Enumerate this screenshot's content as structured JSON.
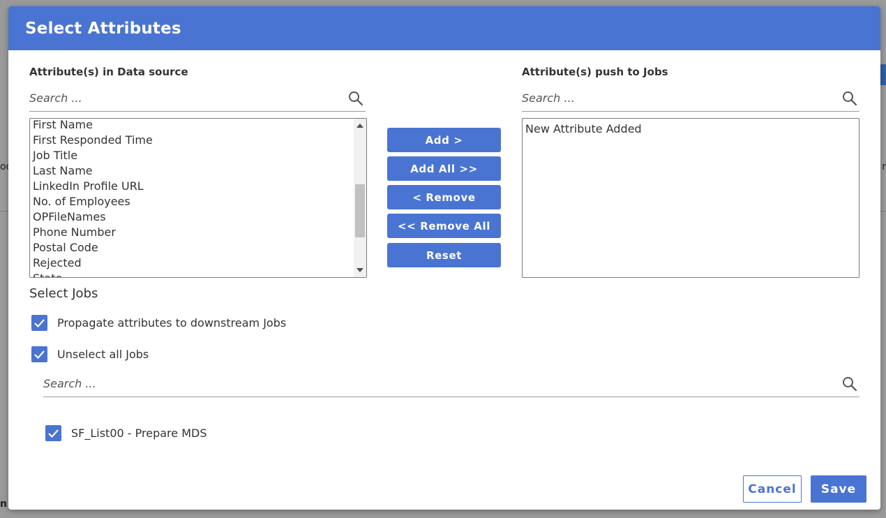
{
  "background": {
    "frag_left_1": "oo",
    "frag_right_1": "r",
    "frag_bottom_left": "n"
  },
  "modal": {
    "title": "Select Attributes"
  },
  "source_panel": {
    "label": "Attribute(s) in Data source",
    "search_placeholder": "Search ...",
    "items": [
      "First Name",
      "First Responded Time",
      "Job Title",
      "Last Name",
      "LinkedIn Profile URL",
      "No. of Employees",
      "OPFileNames",
      "Phone Number",
      "Postal Code",
      "Rejected",
      "State"
    ]
  },
  "target_panel": {
    "label": "Attribute(s) push to Jobs",
    "search_placeholder": "Search ...",
    "items": [
      "New Attribute Added"
    ]
  },
  "actions": {
    "add": "Add >",
    "add_all": "Add All >>",
    "remove": "< Remove",
    "remove_all": "<< Remove All",
    "reset": "Reset"
  },
  "jobs": {
    "title": "Select Jobs",
    "propagate_label": "Propagate attributes to downstream Jobs",
    "propagate_checked": true,
    "unselect_label": "Unselect all Jobs",
    "unselect_checked": true,
    "search_placeholder": "Search ...",
    "items": [
      {
        "label": "SF_List00 - Prepare MDS",
        "checked": true
      }
    ]
  },
  "footer": {
    "cancel": "Cancel",
    "save": "Save"
  },
  "colors": {
    "accent": "#4a74d2",
    "text": "#333333",
    "overlay": "#9a9a9a"
  }
}
